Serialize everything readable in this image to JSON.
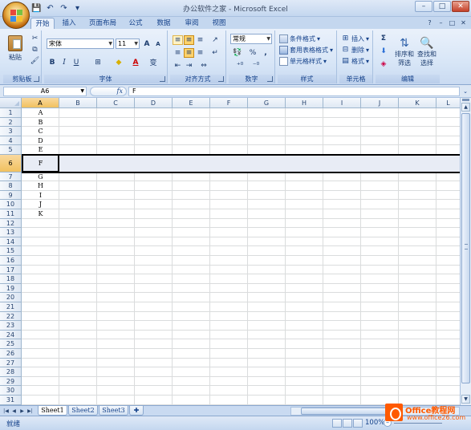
{
  "window": {
    "title": "办公软件之家 - Microsoft Excel",
    "controls": {
      "minimize": "–",
      "maximize": "□",
      "close": "✕"
    }
  },
  "qat": {
    "save_icon": "💾",
    "undo_icon": "↶",
    "redo_icon": "↷",
    "customize_icon": "▾"
  },
  "tabs": [
    {
      "label": "开始",
      "active": true
    },
    {
      "label": "插入",
      "active": false
    },
    {
      "label": "页面布局",
      "active": false
    },
    {
      "label": "公式",
      "active": false
    },
    {
      "label": "数据",
      "active": false
    },
    {
      "label": "审阅",
      "active": false
    },
    {
      "label": "视图",
      "active": false
    }
  ],
  "ribbon": {
    "clipboard": {
      "label": "剪贴板",
      "paste": "粘贴"
    },
    "font": {
      "label": "字体",
      "font_name": "宋体",
      "font_size": "11",
      "bold": "B",
      "italic": "I",
      "underline": "U",
      "grow": "A",
      "shrink": "A",
      "phonetic": "变"
    },
    "alignment": {
      "label": "对齐方式"
    },
    "number": {
      "label": "数字",
      "format": "常规",
      "percent": "%",
      "comma": ","
    },
    "styles": {
      "label": "样式",
      "conditional": "条件格式",
      "table": "套用表格格式",
      "cell_styles": "单元格样式"
    },
    "cells": {
      "label": "单元格",
      "insert": "插入",
      "delete": "删除",
      "format": "格式"
    },
    "editing": {
      "label": "编辑",
      "sigma": "Σ",
      "sort_line1": "排序和",
      "sort_line2": "筛选",
      "find_line1": "查找和",
      "find_line2": "选择"
    }
  },
  "formula_bar": {
    "name_box": "A6",
    "fx": "fx",
    "value": "F"
  },
  "sheet": {
    "columns": [
      "A",
      "B",
      "C",
      "D",
      "E",
      "F",
      "G",
      "H",
      "I",
      "J",
      "K",
      "L"
    ],
    "selected_column": "A",
    "selected_row": 6,
    "rows": [
      "1",
      "2",
      "3",
      "4",
      "5",
      "6",
      "7",
      "8",
      "9",
      "10",
      "11",
      "12",
      "13",
      "14",
      "15",
      "16",
      "17",
      "18",
      "19",
      "20",
      "21",
      "22",
      "23",
      "24",
      "25",
      "26",
      "27",
      "28",
      "29",
      "30",
      "31"
    ],
    "column_a_values": [
      "A",
      "B",
      "C",
      "D",
      "E",
      "F",
      "G",
      "H",
      "I",
      "J",
      "K"
    ]
  },
  "sheet_tabs": [
    {
      "label": "Sheet1",
      "active": true
    },
    {
      "label": "Sheet2",
      "active": false
    },
    {
      "label": "Sheet3",
      "active": false
    }
  ],
  "status": {
    "text": "就绪",
    "zoom": "100%",
    "zoom_minus": "–"
  },
  "watermark": {
    "line1": "Office教程网",
    "line2": "www.office26.com"
  },
  "colors": {
    "accent": "#15428b",
    "selected_header": "#f1c15f",
    "watermark": "#ff5a00"
  }
}
